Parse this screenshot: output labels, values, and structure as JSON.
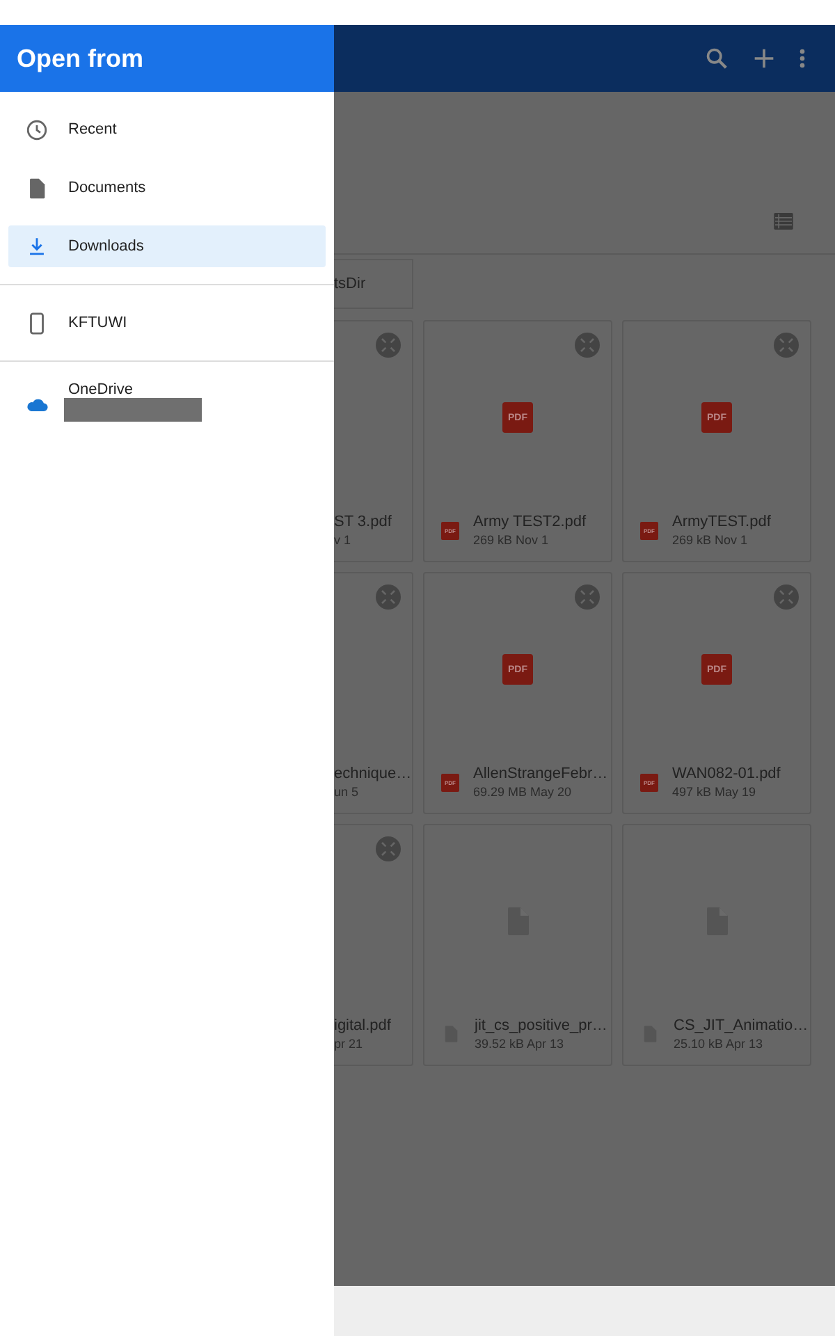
{
  "drawer": {
    "title": "Open from",
    "sections": [
      [
        {
          "kind": "recent",
          "label": "Recent",
          "selected": false,
          "redacted": false
        },
        {
          "kind": "documents",
          "label": "Documents",
          "selected": false,
          "redacted": false
        },
        {
          "kind": "downloads",
          "label": "Downloads",
          "selected": true,
          "redacted": false
        }
      ],
      [
        {
          "kind": "device",
          "label": "KFTUWI",
          "selected": false,
          "redacted": false
        }
      ],
      [
        {
          "kind": "cloud",
          "label": "OneDrive",
          "selected": false,
          "redacted": true
        }
      ]
    ]
  },
  "folder_chip": "tsDir",
  "rows": [
    [
      {
        "kind": "partial",
        "name": "ST 3.pdf",
        "meta": "v 1",
        "expand_badge": true
      },
      {
        "kind": "pdf",
        "thumb_label": "PDF",
        "icon_label": "PDF",
        "name": "Army TEST2.pdf",
        "meta": "269 kB Nov 1",
        "expand_badge": true
      },
      {
        "kind": "pdf",
        "thumb_label": "PDF",
        "icon_label": "PDF",
        "name": "ArmyTEST.pdf",
        "meta": "269 kB Nov 1",
        "expand_badge": true
      }
    ],
    [
      {
        "kind": "partial",
        "name": "echnique…",
        "meta": "un 5",
        "expand_badge": true
      },
      {
        "kind": "pdf",
        "thumb_label": "PDF",
        "icon_label": "PDF",
        "name": "AllenStrangeFebr…",
        "meta": "69.29 MB May 20",
        "expand_badge": true
      },
      {
        "kind": "pdf",
        "thumb_label": "PDF",
        "icon_label": "PDF",
        "name": "WAN082-01.pdf",
        "meta": "497 kB May 19",
        "expand_badge": true
      }
    ],
    [
      {
        "kind": "partial",
        "name": "igital.pdf",
        "meta": "pr 21",
        "expand_badge": true
      },
      {
        "kind": "generic",
        "name": "jit_cs_positive_pr…",
        "meta": "39.52 kB Apr 13",
        "expand_badge": false
      },
      {
        "kind": "generic",
        "name": "CS_JIT_Animatio…",
        "meta": "25.10 kB Apr 13",
        "expand_badge": false
      }
    ]
  ]
}
